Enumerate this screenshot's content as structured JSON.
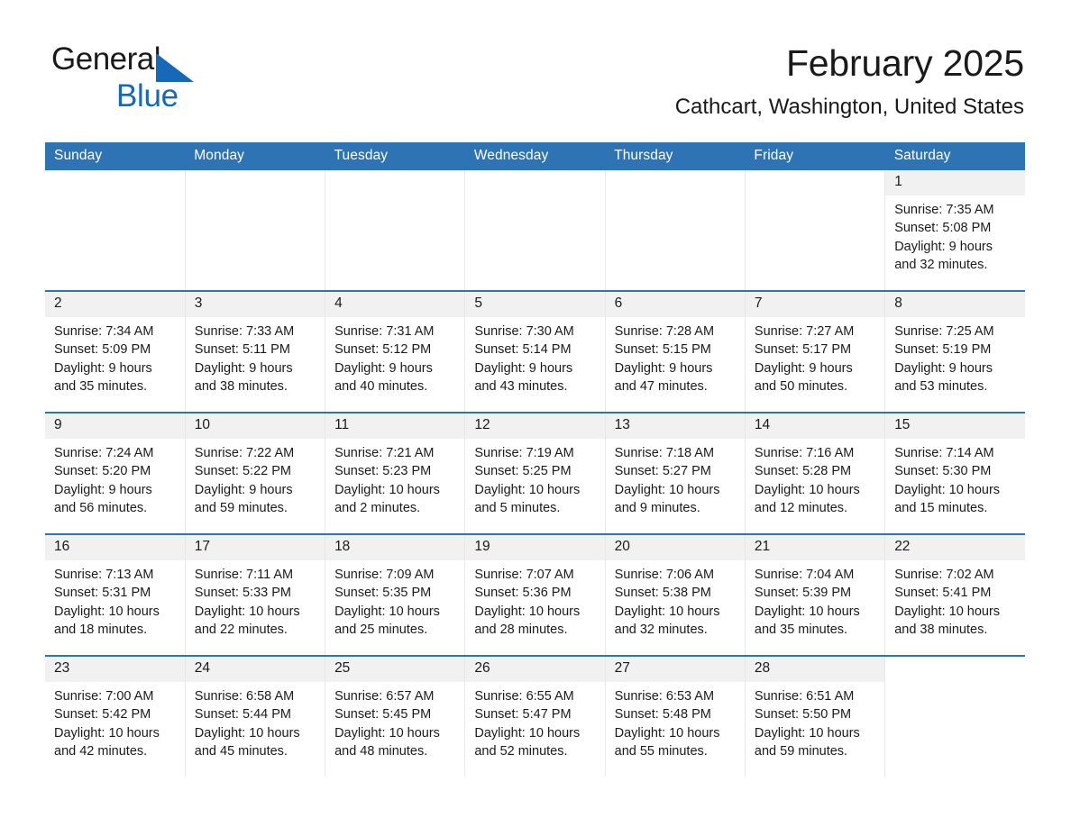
{
  "brand": {
    "name_part1": "General",
    "name_part2": "Blue",
    "triangle_color": "#1668b8"
  },
  "header": {
    "month_title": "February 2025",
    "location": "Cathcart, Washington, United States"
  },
  "theme": {
    "header_blue": "#2e74b5",
    "daynum_band": "#f1f1f1",
    "text": "#1a1a1a"
  },
  "weekday_headers": [
    "Sunday",
    "Monday",
    "Tuesday",
    "Wednesday",
    "Thursday",
    "Friday",
    "Saturday"
  ],
  "weeks": [
    [
      {
        "day": "",
        "blank": true
      },
      {
        "day": "",
        "blank": true
      },
      {
        "day": "",
        "blank": true
      },
      {
        "day": "",
        "blank": true
      },
      {
        "day": "",
        "blank": true
      },
      {
        "day": "",
        "blank": true
      },
      {
        "day": "1",
        "sunrise": "Sunrise: 7:35 AM",
        "sunset": "Sunset: 5:08 PM",
        "daylight_line1": "Daylight: 9 hours",
        "daylight_line2": "and 32 minutes."
      }
    ],
    [
      {
        "day": "2",
        "sunrise": "Sunrise: 7:34 AM",
        "sunset": "Sunset: 5:09 PM",
        "daylight_line1": "Daylight: 9 hours",
        "daylight_line2": "and 35 minutes."
      },
      {
        "day": "3",
        "sunrise": "Sunrise: 7:33 AM",
        "sunset": "Sunset: 5:11 PM",
        "daylight_line1": "Daylight: 9 hours",
        "daylight_line2": "and 38 minutes."
      },
      {
        "day": "4",
        "sunrise": "Sunrise: 7:31 AM",
        "sunset": "Sunset: 5:12 PM",
        "daylight_line1": "Daylight: 9 hours",
        "daylight_line2": "and 40 minutes."
      },
      {
        "day": "5",
        "sunrise": "Sunrise: 7:30 AM",
        "sunset": "Sunset: 5:14 PM",
        "daylight_line1": "Daylight: 9 hours",
        "daylight_line2": "and 43 minutes."
      },
      {
        "day": "6",
        "sunrise": "Sunrise: 7:28 AM",
        "sunset": "Sunset: 5:15 PM",
        "daylight_line1": "Daylight: 9 hours",
        "daylight_line2": "and 47 minutes."
      },
      {
        "day": "7",
        "sunrise": "Sunrise: 7:27 AM",
        "sunset": "Sunset: 5:17 PM",
        "daylight_line1": "Daylight: 9 hours",
        "daylight_line2": "and 50 minutes."
      },
      {
        "day": "8",
        "sunrise": "Sunrise: 7:25 AM",
        "sunset": "Sunset: 5:19 PM",
        "daylight_line1": "Daylight: 9 hours",
        "daylight_line2": "and 53 minutes."
      }
    ],
    [
      {
        "day": "9",
        "sunrise": "Sunrise: 7:24 AM",
        "sunset": "Sunset: 5:20 PM",
        "daylight_line1": "Daylight: 9 hours",
        "daylight_line2": "and 56 minutes."
      },
      {
        "day": "10",
        "sunrise": "Sunrise: 7:22 AM",
        "sunset": "Sunset: 5:22 PM",
        "daylight_line1": "Daylight: 9 hours",
        "daylight_line2": "and 59 minutes."
      },
      {
        "day": "11",
        "sunrise": "Sunrise: 7:21 AM",
        "sunset": "Sunset: 5:23 PM",
        "daylight_line1": "Daylight: 10 hours",
        "daylight_line2": "and 2 minutes."
      },
      {
        "day": "12",
        "sunrise": "Sunrise: 7:19 AM",
        "sunset": "Sunset: 5:25 PM",
        "daylight_line1": "Daylight: 10 hours",
        "daylight_line2": "and 5 minutes."
      },
      {
        "day": "13",
        "sunrise": "Sunrise: 7:18 AM",
        "sunset": "Sunset: 5:27 PM",
        "daylight_line1": "Daylight: 10 hours",
        "daylight_line2": "and 9 minutes."
      },
      {
        "day": "14",
        "sunrise": "Sunrise: 7:16 AM",
        "sunset": "Sunset: 5:28 PM",
        "daylight_line1": "Daylight: 10 hours",
        "daylight_line2": "and 12 minutes."
      },
      {
        "day": "15",
        "sunrise": "Sunrise: 7:14 AM",
        "sunset": "Sunset: 5:30 PM",
        "daylight_line1": "Daylight: 10 hours",
        "daylight_line2": "and 15 minutes."
      }
    ],
    [
      {
        "day": "16",
        "sunrise": "Sunrise: 7:13 AM",
        "sunset": "Sunset: 5:31 PM",
        "daylight_line1": "Daylight: 10 hours",
        "daylight_line2": "and 18 minutes."
      },
      {
        "day": "17",
        "sunrise": "Sunrise: 7:11 AM",
        "sunset": "Sunset: 5:33 PM",
        "daylight_line1": "Daylight: 10 hours",
        "daylight_line2": "and 22 minutes."
      },
      {
        "day": "18",
        "sunrise": "Sunrise: 7:09 AM",
        "sunset": "Sunset: 5:35 PM",
        "daylight_line1": "Daylight: 10 hours",
        "daylight_line2": "and 25 minutes."
      },
      {
        "day": "19",
        "sunrise": "Sunrise: 7:07 AM",
        "sunset": "Sunset: 5:36 PM",
        "daylight_line1": "Daylight: 10 hours",
        "daylight_line2": "and 28 minutes."
      },
      {
        "day": "20",
        "sunrise": "Sunrise: 7:06 AM",
        "sunset": "Sunset: 5:38 PM",
        "daylight_line1": "Daylight: 10 hours",
        "daylight_line2": "and 32 minutes."
      },
      {
        "day": "21",
        "sunrise": "Sunrise: 7:04 AM",
        "sunset": "Sunset: 5:39 PM",
        "daylight_line1": "Daylight: 10 hours",
        "daylight_line2": "and 35 minutes."
      },
      {
        "day": "22",
        "sunrise": "Sunrise: 7:02 AM",
        "sunset": "Sunset: 5:41 PM",
        "daylight_line1": "Daylight: 10 hours",
        "daylight_line2": "and 38 minutes."
      }
    ],
    [
      {
        "day": "23",
        "sunrise": "Sunrise: 7:00 AM",
        "sunset": "Sunset: 5:42 PM",
        "daylight_line1": "Daylight: 10 hours",
        "daylight_line2": "and 42 minutes."
      },
      {
        "day": "24",
        "sunrise": "Sunrise: 6:58 AM",
        "sunset": "Sunset: 5:44 PM",
        "daylight_line1": "Daylight: 10 hours",
        "daylight_line2": "and 45 minutes."
      },
      {
        "day": "25",
        "sunrise": "Sunrise: 6:57 AM",
        "sunset": "Sunset: 5:45 PM",
        "daylight_line1": "Daylight: 10 hours",
        "daylight_line2": "and 48 minutes."
      },
      {
        "day": "26",
        "sunrise": "Sunrise: 6:55 AM",
        "sunset": "Sunset: 5:47 PM",
        "daylight_line1": "Daylight: 10 hours",
        "daylight_line2": "and 52 minutes."
      },
      {
        "day": "27",
        "sunrise": "Sunrise: 6:53 AM",
        "sunset": "Sunset: 5:48 PM",
        "daylight_line1": "Daylight: 10 hours",
        "daylight_line2": "and 55 minutes."
      },
      {
        "day": "28",
        "sunrise": "Sunrise: 6:51 AM",
        "sunset": "Sunset: 5:50 PM",
        "daylight_line1": "Daylight: 10 hours",
        "daylight_line2": "and 59 minutes."
      },
      {
        "day": "",
        "blank": true
      }
    ]
  ]
}
